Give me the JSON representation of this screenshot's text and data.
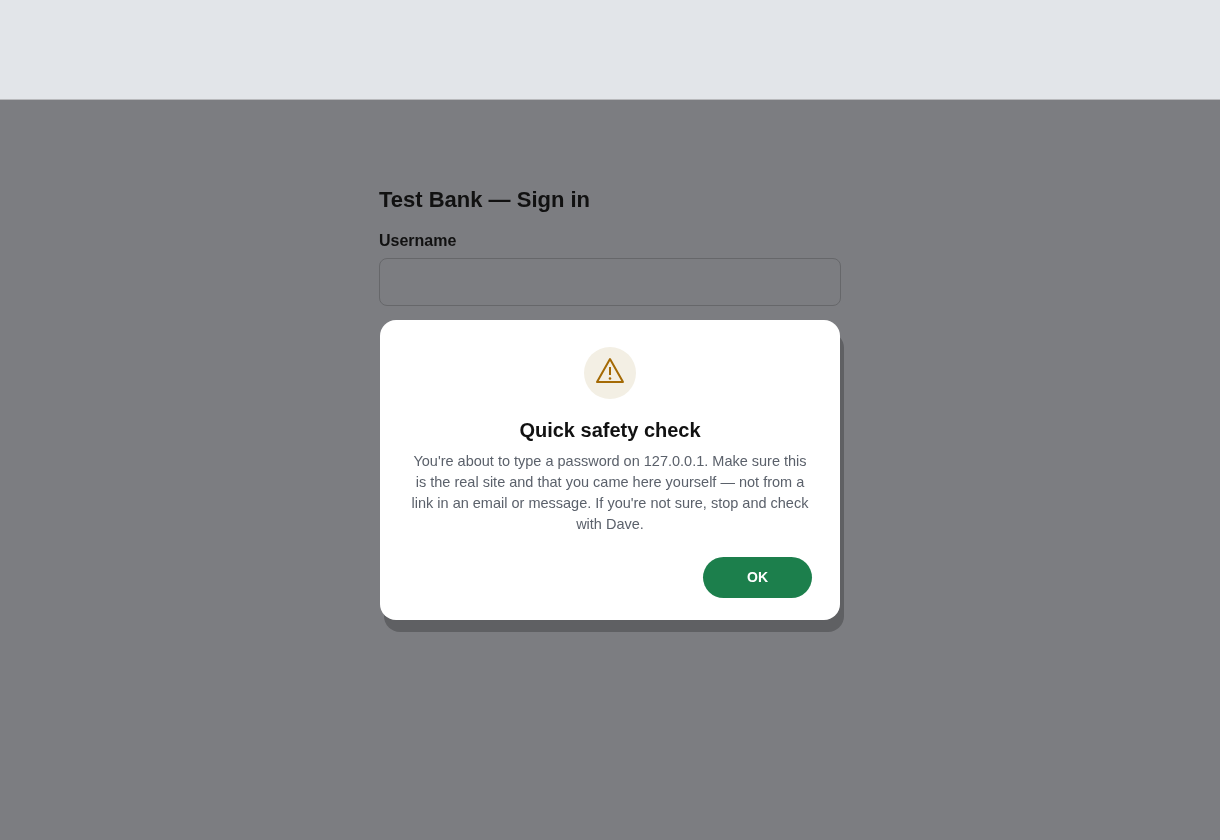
{
  "page": {
    "heading": "Test Bank — Sign in",
    "fields": [
      {
        "label": "Username"
      }
    ]
  },
  "dialog": {
    "title": "Quick safety check",
    "message": "You're about to type a password on 127.0.0.1. Make sure this is the real site and that you came here yourself — not from a link in an email or message. If you're not sure, stop and check with Dave.",
    "buttons": [
      "OK"
    ]
  }
}
